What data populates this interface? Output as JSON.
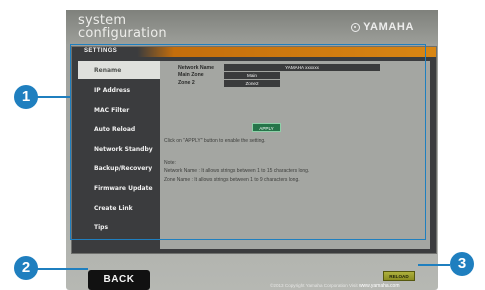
{
  "brand": {
    "line1": "system",
    "line2": "configuration",
    "logo": "YAMAHA"
  },
  "section_title": "SETTINGS",
  "sidebar": {
    "items": [
      {
        "label": "Rename",
        "active": true
      },
      {
        "label": "IP Address",
        "active": false
      },
      {
        "label": "MAC Filter",
        "active": false
      },
      {
        "label": "Auto Reload",
        "active": false
      },
      {
        "label": "Network Standby",
        "active": false
      },
      {
        "label": "Backup/Recovery",
        "active": false
      },
      {
        "label": "Firmware Update",
        "active": false
      },
      {
        "label": "Create Link",
        "active": false
      },
      {
        "label": "Tips",
        "active": false
      }
    ]
  },
  "rename": {
    "fields": [
      {
        "label": "Network Name",
        "value": "YAMAHA xxxxxx"
      },
      {
        "label": "Main Zone",
        "value": "Main"
      },
      {
        "label": "Zone 2",
        "value": "Zone2"
      }
    ],
    "apply_label": "APPLY",
    "instruction": "Click on \"APPLY\" button to enable the setting.",
    "note_title": "Note:",
    "note_lines": [
      "Network Name : It allows strings between 1 to 15 characters long.",
      "Zone Name : It allows strings between 1 to 9 characters long."
    ]
  },
  "footer": {
    "back_label": "BACK",
    "reload_label": "RELOAD",
    "copyright": "©2013 Copyright Yamaha Corporation Visit",
    "copyright_url": "www.yamaha.com"
  },
  "callouts": [
    "1",
    "2",
    "3"
  ],
  "colors": {
    "accent_orange": "#d98613",
    "apply_green": "#26754a",
    "reload_olive": "#8b8d22",
    "callout_blue": "#1f7fbf"
  },
  "icons": {
    "logo_mark": "yamaha-tuning-fork-logo-icon"
  }
}
